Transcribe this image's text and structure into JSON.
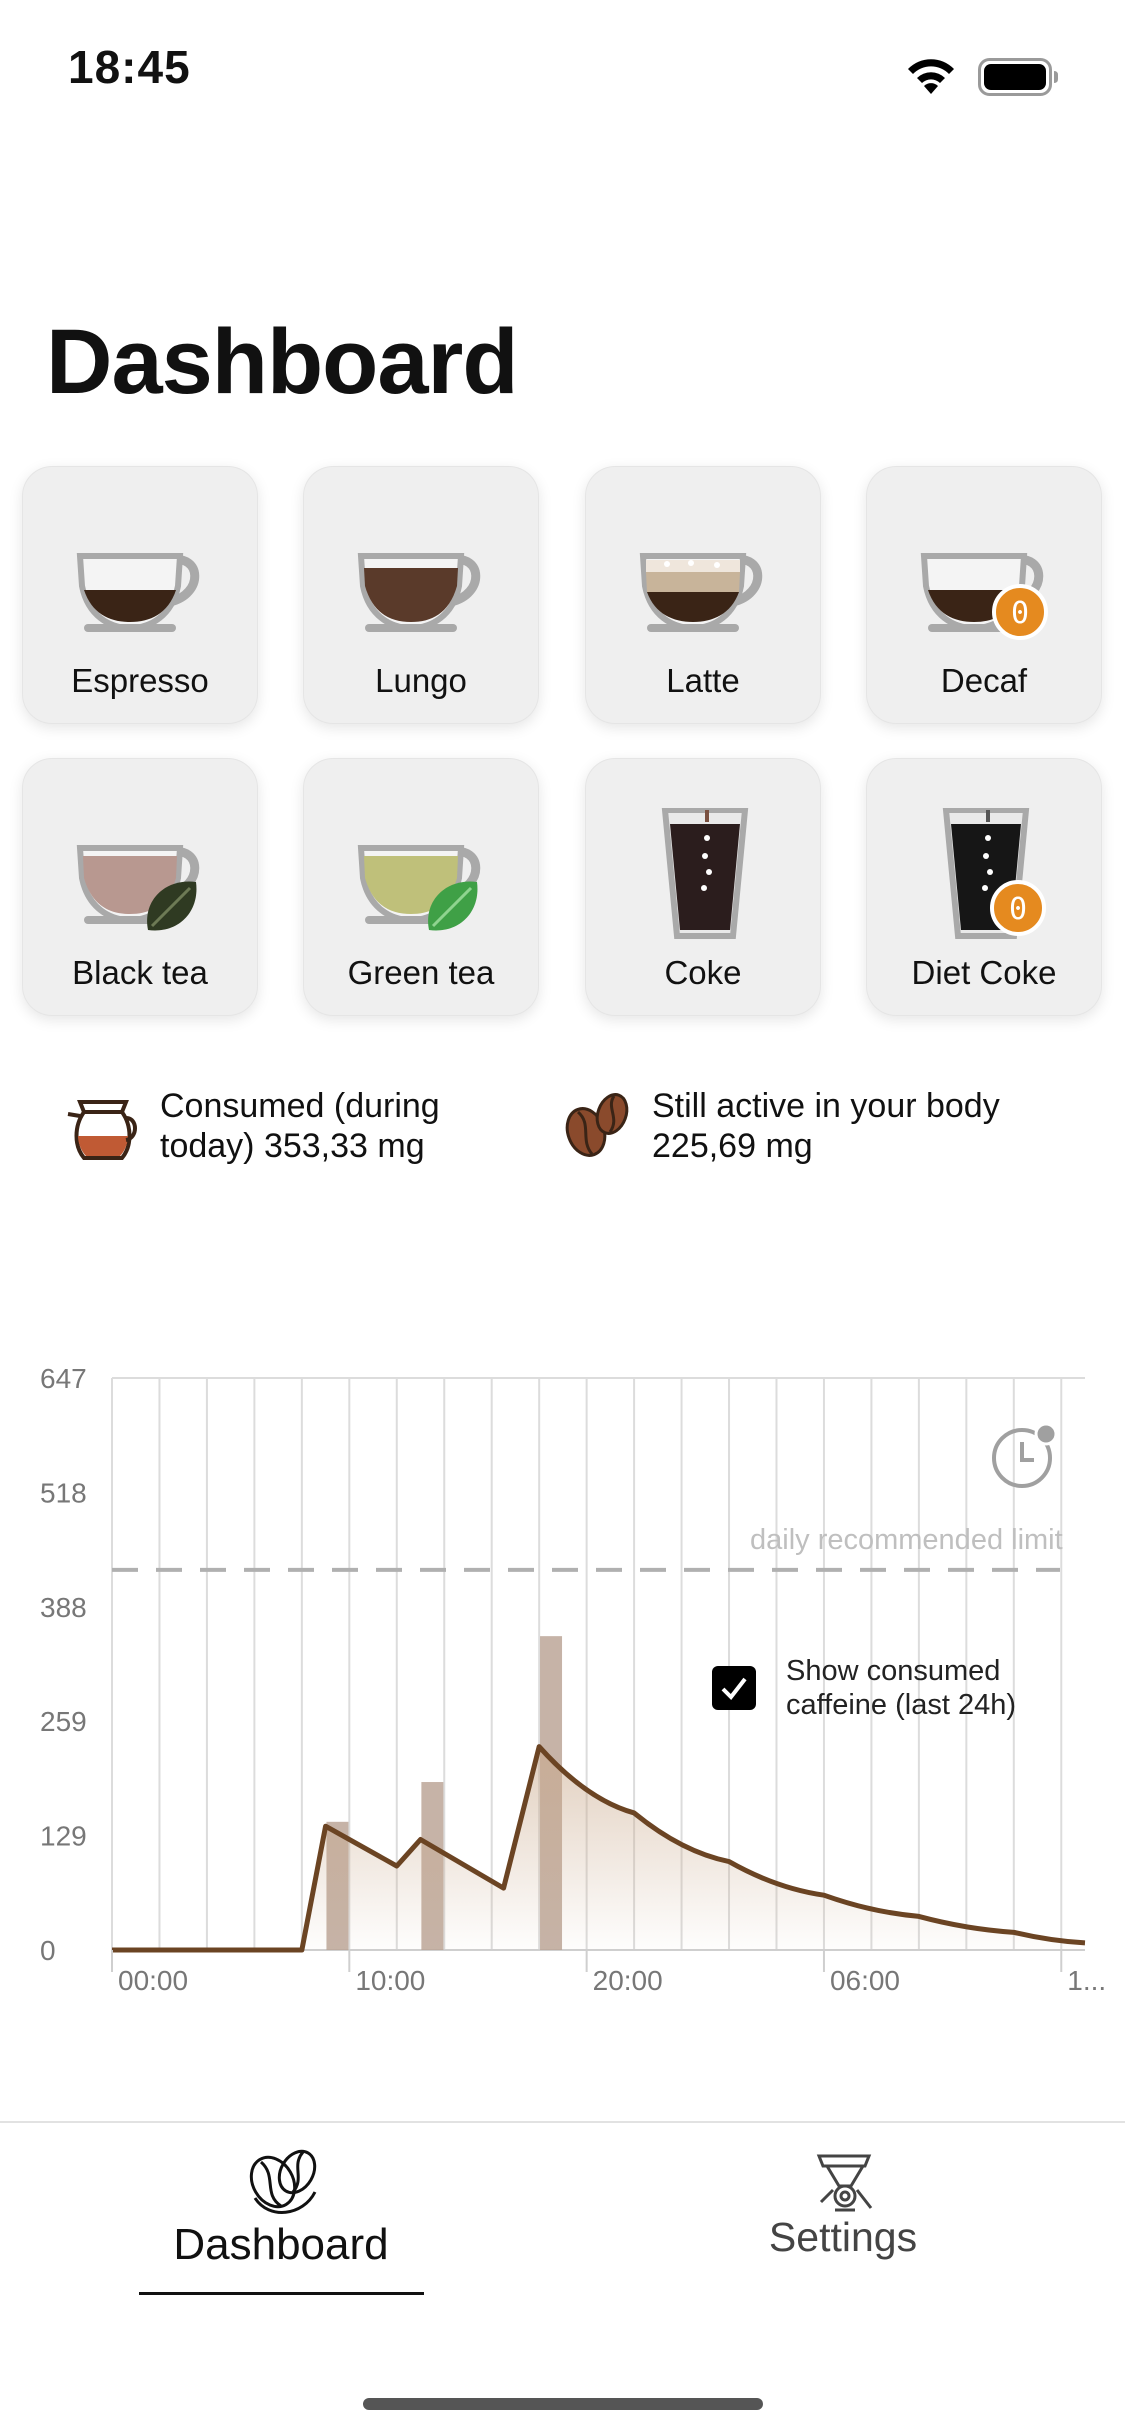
{
  "status": {
    "time": "18:45"
  },
  "page": {
    "title": "Dashboard"
  },
  "drinks": [
    {
      "label": "Espresso",
      "icon": "espresso-cup-icon"
    },
    {
      "label": "Lungo",
      "icon": "lungo-cup-icon"
    },
    {
      "label": "Latte",
      "icon": "latte-cup-icon"
    },
    {
      "label": "Decaf",
      "icon": "decaf-cup-icon",
      "badge": "0"
    },
    {
      "label": "Black tea",
      "icon": "black-tea-cup-icon"
    },
    {
      "label": "Green tea",
      "icon": "green-tea-cup-icon"
    },
    {
      "label": "Coke",
      "icon": "coke-glass-icon"
    },
    {
      "label": "Diet Coke",
      "icon": "diet-coke-glass-icon",
      "badge": "0"
    }
  ],
  "stats": {
    "consumed_line1": "Consumed (during",
    "consumed_line2": "today) 353,33 mg",
    "active_line1": "Still active in your body",
    "active_line2": "225,69 mg"
  },
  "chart_data": {
    "type": "line",
    "y_ticks": [
      "647",
      "518",
      "388",
      "259",
      "129",
      "0"
    ],
    "x_ticks": [
      "00:00",
      "10:00",
      "20:00",
      "06:00",
      "1..."
    ],
    "ylim": [
      0,
      647
    ],
    "x_range_hours": [
      0,
      41
    ],
    "limit": {
      "label": "daily recommended limit",
      "value": 430
    },
    "bars": [
      {
        "x": 9.5,
        "value": 145
      },
      {
        "x": 13.5,
        "value": 190
      },
      {
        "x": 18.5,
        "value": 355
      }
    ],
    "series": [
      {
        "x": [
          0,
          8,
          9,
          12,
          13,
          16.5,
          18,
          22,
          26,
          30,
          34,
          38,
          41
        ],
        "y": [
          0,
          0,
          140,
          95,
          125,
          70,
          230,
          155,
          100,
          62,
          38,
          20,
          8
        ]
      }
    ],
    "toggle": {
      "label_line1": "Show consumed",
      "label_line2": "caffeine (last 24h)",
      "checked": true
    },
    "colors": {
      "line": "#6b4423",
      "bar": "#b8a091",
      "fill": "#c9a88a",
      "limit": "#b0b0b0"
    }
  },
  "tabs": [
    {
      "label": "Dashboard",
      "icon": "coffee-beans-icon",
      "active": true
    },
    {
      "label": "Settings",
      "icon": "coffee-grinder-icon",
      "active": false
    }
  ]
}
